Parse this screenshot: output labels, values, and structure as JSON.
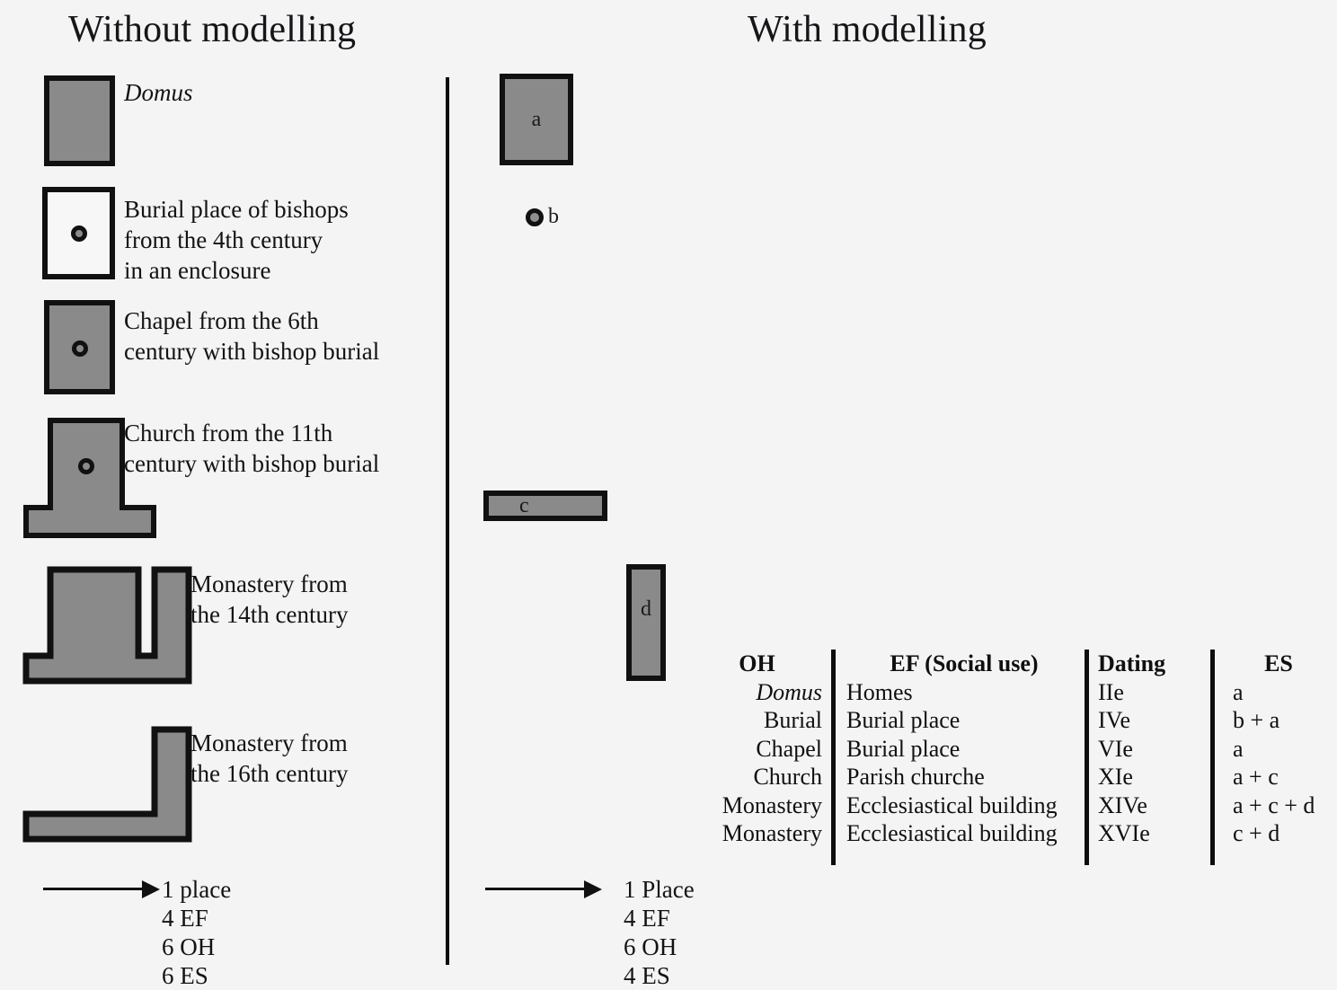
{
  "panels": {
    "left_title": "Without modelling",
    "right_title": "With modelling"
  },
  "legend": {
    "items": [
      {
        "key": "domus",
        "label": "Domus",
        "italic": true,
        "shape": "filled-rect",
        "has_bishop_dot": false
      },
      {
        "key": "burial-enclosure",
        "label": "Burial place of bishops\nfrom the 4th century\nin an enclosure",
        "italic": false,
        "shape": "open-rect",
        "has_bishop_dot": true
      },
      {
        "key": "chapel",
        "label": "Chapel from the 6th\ncentury with bishop burial",
        "italic": false,
        "shape": "filled-rect",
        "has_bishop_dot": true
      },
      {
        "key": "church",
        "label": "Church from the 11th\ncentury with bishop burial",
        "italic": false,
        "shape": "t-shape",
        "has_bishop_dot": true
      },
      {
        "key": "monastery-14",
        "label": "Monastery from\nthe 14th century",
        "italic": false,
        "shape": "u-shape",
        "has_bishop_dot": false
      },
      {
        "key": "monastery-16",
        "label": "Monastery from\nthe 16th century",
        "italic": false,
        "shape": "l-shape-mirrored",
        "has_bishop_dot": false
      }
    ]
  },
  "summary_left": {
    "lines": [
      "1 place",
      "4 EF",
      "6 OH",
      "6 ES"
    ]
  },
  "summary_right": {
    "lines": [
      "1 Place",
      "4 EF",
      "6 OH",
      "4 ES"
    ]
  },
  "plan_units": [
    {
      "id": "a",
      "label": "a"
    },
    {
      "id": "b",
      "label": "b"
    },
    {
      "id": "c",
      "label": "c"
    },
    {
      "id": "d",
      "label": "d"
    }
  ],
  "table": {
    "headers": [
      "OH",
      "EF (Social use)",
      "Dating",
      "ES"
    ],
    "rows": [
      {
        "oh": "Domus",
        "oh_italic": true,
        "ef": "Homes",
        "dating": "IIe",
        "es": "a"
      },
      {
        "oh": "Burial",
        "oh_italic": false,
        "ef": "Burial place",
        "dating": "IVe",
        "es": "b + a"
      },
      {
        "oh": "Chapel",
        "oh_italic": false,
        "ef": "Burial place",
        "dating": "VIe",
        "es": "a"
      },
      {
        "oh": "Church",
        "oh_italic": false,
        "ef": "Parish churche",
        "dating": "XIe",
        "es": "a + c"
      },
      {
        "oh": "Monastery",
        "oh_italic": false,
        "ef": "Ecclesiastical building",
        "dating": "XIVe",
        "es": "a + c + d"
      },
      {
        "oh": "Monastery",
        "oh_italic": false,
        "ef": "Ecclesiastical building",
        "dating": "XVIe",
        "es": "c + d"
      }
    ]
  },
  "colors": {
    "background": "#f4f4f4",
    "shape_fill": "#8a8a8a",
    "outline": "#111111",
    "text": "#131313"
  }
}
